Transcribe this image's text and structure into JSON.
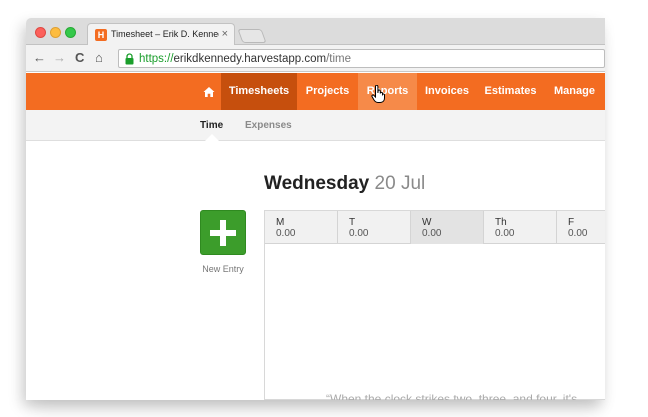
{
  "browser": {
    "tab_title": "Timesheet – Erik D. Kenned",
    "tab_close": "×",
    "url_scheme": "https://",
    "url_host": "erikdkennedy.harvestapp.com",
    "url_path": "/time",
    "back": "←",
    "forward": "→",
    "reload": "C",
    "home": "⌂"
  },
  "nav": {
    "home_icon": "house-icon",
    "items": [
      "Timesheets",
      "Projects",
      "Reports",
      "Invoices",
      "Estimates",
      "Manage"
    ],
    "active": "Timesheets",
    "hovered": "Reports"
  },
  "subnav": {
    "time": "Time",
    "expenses": "Expenses",
    "active": "Time"
  },
  "main": {
    "day_name": "Wednesday",
    "date": "20 Jul",
    "new_entry_label": "New Entry",
    "week": [
      {
        "letter": "M",
        "hours": "0.00"
      },
      {
        "letter": "T",
        "hours": "0.00"
      },
      {
        "letter": "W",
        "hours": "0.00"
      },
      {
        "letter": "Th",
        "hours": "0.00"
      },
      {
        "letter": "F",
        "hours": "0.00"
      }
    ],
    "quote": "“When the clock strikes two, three, and four, it's"
  },
  "colors": {
    "brand_orange": "#f36c21",
    "active_tab": "#c64f0d",
    "new_entry_green": "#3c9d2b"
  }
}
